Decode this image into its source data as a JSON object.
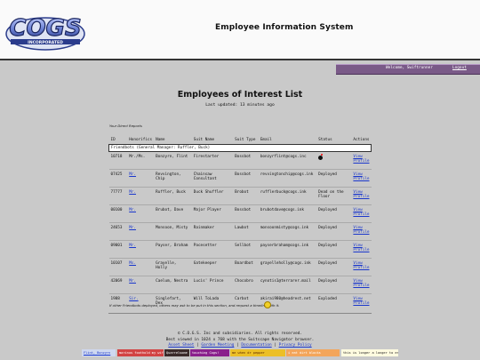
{
  "header": {
    "logo_text": "COGS",
    "logo_subtext": "INCORPORATED",
    "site_title": "Employee Information System"
  },
  "userbar": {
    "welcome": "Welcome, Swiftrunner",
    "logout": "Logout"
  },
  "main": {
    "heading": "Employees of Interest List",
    "updated": "Last updated: 13 minutes ago",
    "direct_reports_label": "Your Direct Reports"
  },
  "table": {
    "columns": [
      "ID",
      "Honorifics",
      "Name",
      "Suit Name",
      "Suit Type",
      "Email",
      "Status",
      "Actions"
    ],
    "group_row": "Friendbots (General Manager: Ruffler, Buck)",
    "rows": [
      {
        "id": "10718",
        "hon": "Mr./Ms.",
        "name": "Bonzyrn, Flint",
        "suit": "Firestarter",
        "type": "Bossbot",
        "email": "bonzyrflint@cogs.inc",
        "status": "",
        "status_icon": "bomb-icon",
        "action": "View Profile"
      },
      {
        "id": "07425",
        "hon": "Mr.",
        "name": "Revvington, Chip",
        "suit": "Chainsaw Consultant",
        "type": "Bossbot",
        "email": "revvingtonchip@cogs.ink",
        "status": "Deployed",
        "action": "View Profile"
      },
      {
        "id": "77777",
        "hon": "Mr.",
        "name": "Ruffler, Buck",
        "suit": "Duck Shuffler",
        "type": "Brobot",
        "email": "rufflerbuck@cogs.ink",
        "status": "Dead on the Floor",
        "action": "View Profile"
      },
      {
        "id": "00100",
        "hon": "Mr.",
        "name": "Brubot, Dave",
        "suit": "Major Player",
        "type": "Bossbot",
        "email": "brubotdave@cogs.ink",
        "status": "Deployed",
        "action": "View Profile"
      },
      {
        "id": "24653",
        "hon": "Mr.",
        "name": "Monsoon, Misty",
        "suit": "Rainmaker",
        "type": "Lawbot",
        "email": "monsoonmisty@cogs.ink",
        "status": "Deployed",
        "action": "View Profile"
      },
      {
        "id": "09001",
        "hon": "Mr.",
        "name": "Payser, Braham",
        "suit": "Pacesetter",
        "type": "Sellbot",
        "email": "payserbraham@cogs.ink",
        "status": "Deployed",
        "action": "View Profile"
      },
      {
        "id": "10107",
        "hon": "Ms.",
        "name": "Grayelle, Holly",
        "suit": "Gatekeeper",
        "type": "Boardbot",
        "email": "grayelleholly@cogs.ink",
        "status": "Deployed",
        "action": "View Profile"
      },
      {
        "id": "42069",
        "hon": "Mr.",
        "name": "Caelum, Nestra",
        "suit": "Lucis' Prince",
        "type": "Chocobro",
        "email": "cynotis1@terrarer.mail",
        "status": "Deployed",
        "action": "View Profile"
      },
      {
        "id": "1988",
        "hon": "Sir.",
        "name": "Singlefart, Dex",
        "suit": "Will ToLada",
        "type": "Carbot",
        "email": "akirai980@headrest.net",
        "status": "Exploded",
        "action": "View Profile"
      }
    ]
  },
  "note": {
    "text": "If other Friendbots deployed, others may ask to be put in this section, and request a timeline with it."
  },
  "footer": {
    "copyright": "© C.O.G.S. Inc and subsidiaries. All rights reserved.",
    "best_viewed": "Best viewed in 1024 x 768 with the Suitscape Navigator browser.",
    "links": [
      "Asset Sheet",
      "Garden Meeting",
      "Documentation",
      "Privacy Policy"
    ]
  },
  "badges": [
    {
      "text": "Flint, Bonzyrn",
      "bg": "#cfd8f0",
      "fg": "#1a37cc"
    },
    {
      "text": "marinus foothold my wife",
      "bg": "#d24343",
      "fg": "#ffffff"
    },
    {
      "text": "Quarrelsome",
      "bg": "#3a2a2a",
      "fg": "#ffffff"
    },
    {
      "text": "touching Cogs!",
      "bg": "#8a1f8c",
      "fg": "#ffffff"
    },
    {
      "text": "me when dr pepper",
      "bg": "#ecbf26",
      "fg": "#5b2600"
    },
    {
      "text": "i eat dirt blocks",
      "bg": "#f3a55a",
      "fg": "#ffffff"
    },
    {
      "text": "this is longer a longer to enjoy",
      "bg": "#fffbe0",
      "fg": "#222222"
    }
  ]
}
